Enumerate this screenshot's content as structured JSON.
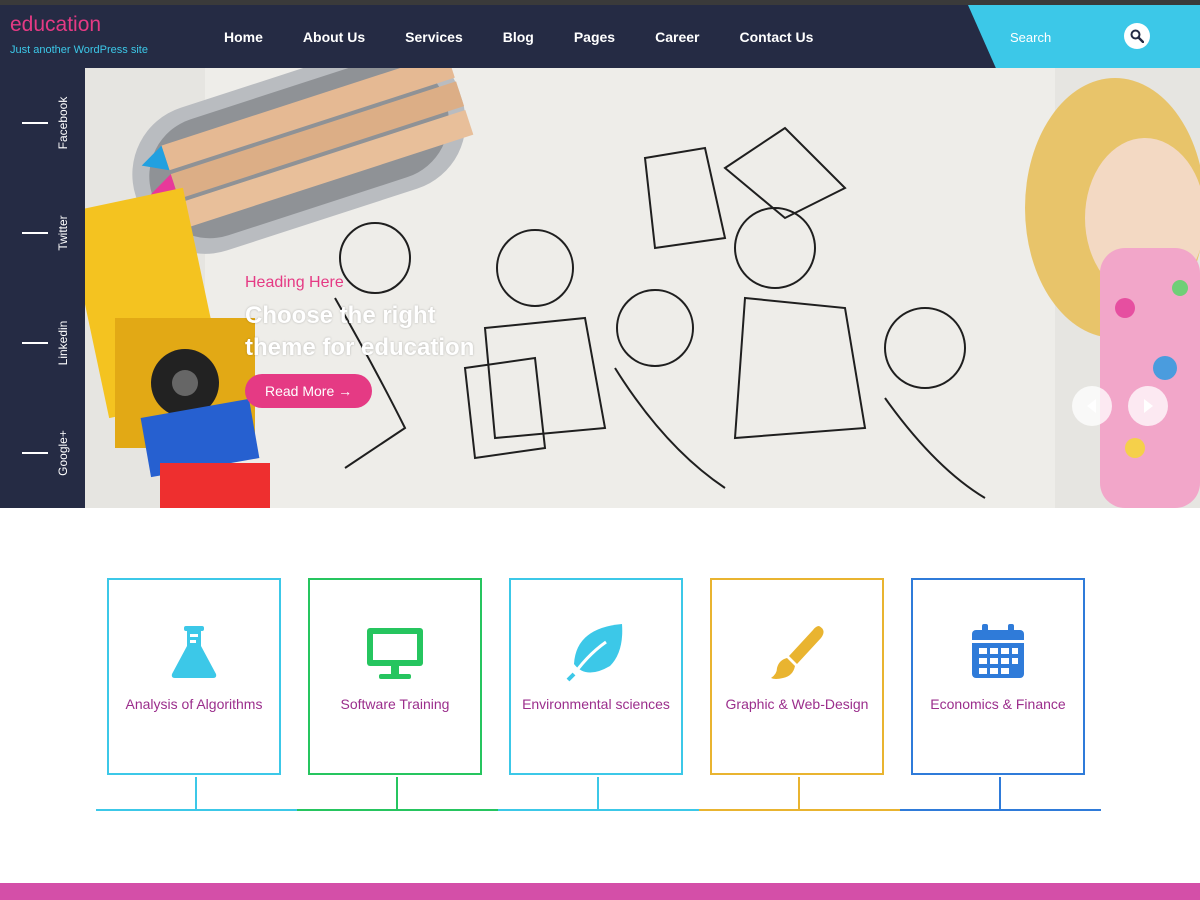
{
  "site": {
    "title": "education",
    "tagline": "Just another WordPress site"
  },
  "nav": {
    "items": [
      "Home",
      "About Us",
      "Services",
      "Blog",
      "Pages",
      "Career",
      "Contact Us"
    ]
  },
  "search": {
    "placeholder": "Search"
  },
  "social": {
    "items": [
      "Facebook",
      "Twitter",
      "Linkedin",
      "Google+"
    ]
  },
  "hero": {
    "subheading": "Heading Here",
    "title": "Choose the right theme for education",
    "button_label": "Read More →"
  },
  "features": [
    {
      "label": "Analysis of Algorithms",
      "icon": "flask-icon",
      "color": "#3cc8e8"
    },
    {
      "label": "Software Training",
      "icon": "monitor-icon",
      "color": "#26c55f"
    },
    {
      "label": "Environmental sciences",
      "icon": "leaf-icon",
      "color": "#3cc8e8"
    },
    {
      "label": "Graphic & Web-Design",
      "icon": "paintbrush-icon",
      "color": "#e9b430"
    },
    {
      "label": "Economics & Finance",
      "icon": "calendar-icon",
      "color": "#2f7bd9"
    }
  ],
  "colors": {
    "header_bg": "#252b44",
    "accent_pink": "#e53a84",
    "accent_cyan": "#3cc8e8",
    "footer_bar": "#d44fa8",
    "card_text": "#9b2e8c"
  }
}
